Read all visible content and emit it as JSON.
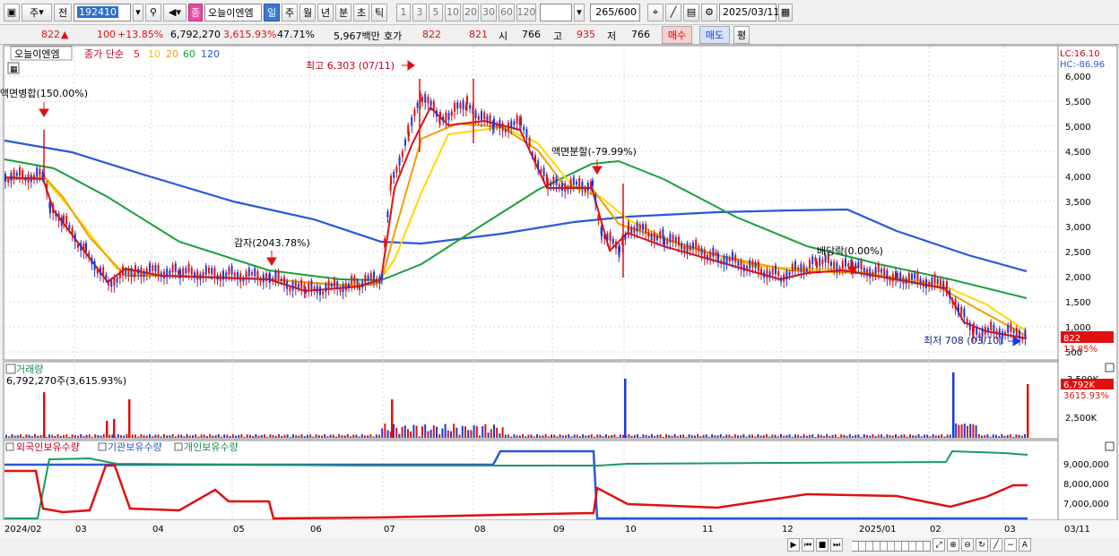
{
  "toolbar": {
    "period_main": "주",
    "prev_label": "전",
    "stock_code": "192410",
    "mark_label": "종",
    "stock_name": "오늘이엔엠",
    "periods": [
      "일",
      "주",
      "월",
      "년",
      "분",
      "초",
      "틱"
    ],
    "period_selected": "일",
    "counts": [
      "1",
      "3",
      "5",
      "10",
      "20",
      "30",
      "60",
      "120"
    ],
    "range_value": "265",
    "range_max": "/600",
    "date": "2025/03/11"
  },
  "quote": {
    "price": "822",
    "change": "100",
    "change_pct": "+13.85%",
    "volume": "6,792,270",
    "volume_pct": "3,615.93%",
    "turnover_pct": "47.71%",
    "amount": "5,967백만",
    "hoga_label": "호가",
    "ask": "822",
    "bid": "821",
    "open_label": "시",
    "open": "766",
    "high_label": "고",
    "high": "935",
    "low_label": "저",
    "low": "766",
    "buy_label": "매수",
    "sell_label": "매도",
    "eval_label": "평"
  },
  "panels": {
    "price": {
      "stock_tag": "오늘이엔엠",
      "ma_title": "종가 단순",
      "ma_periods": [
        "5",
        "10",
        "20",
        "60",
        "120"
      ],
      "ma_colors": [
        "#e01010",
        "#ffd800",
        "#f0a000",
        "#1aa03a",
        "#2a58d8"
      ],
      "lc": "LC:16.10",
      "hc": "HC:-86.96",
      "y_ticks": [
        "6,000",
        "5,500",
        "5,000",
        "4,500",
        "4,000",
        "3,500",
        "3,000",
        "2,500",
        "2,000",
        "1,500",
        "1,000",
        "500"
      ],
      "current_price_tag": "822",
      "current_pct_tag": "13.85%",
      "annotations": {
        "reverse_split": "액면병합(150.00%)",
        "capital_reduction": "감자(2043.78%)",
        "high": "최고 6,303 (07/11)",
        "split": "액면분할(-79.99%)",
        "ex_dividend": "배당락(0.00%)",
        "low": "최저 708 (03/10)"
      }
    },
    "volume": {
      "title": "거래량",
      "value": "6,792,270주(3,615.93%)",
      "y_ticks": [
        "3,500K",
        "2,500K"
      ],
      "current_tag": "6,792K",
      "current_pct": "3615.93%"
    },
    "holdings": {
      "legend": [
        "외국인보유수량",
        "기관보유수량",
        "개인보유수량"
      ],
      "y_ticks": [
        "9,000,000",
        "8,000,000",
        "7,000,000"
      ]
    }
  },
  "x_axis": [
    "2024/02",
    "03",
    "04",
    "05",
    "06",
    "07",
    "08",
    "09",
    "10",
    "11",
    "12",
    "2025/01",
    "02",
    "03",
    "03/11"
  ],
  "colors": {
    "up": "#e01010",
    "down": "#1a3ad8",
    "foreign": "#e01010",
    "institution": "#2a58d8",
    "individual": "#1a9a60"
  }
}
